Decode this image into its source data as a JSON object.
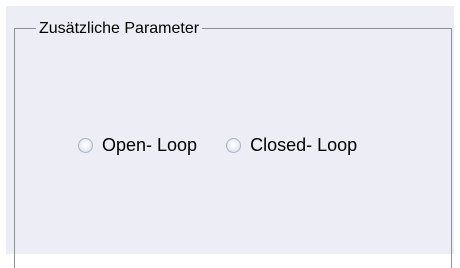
{
  "groupbox": {
    "title": "Zusätzliche Parameter"
  },
  "options": [
    {
      "label": "Open- Loop",
      "selected": false
    },
    {
      "label": "Closed- Loop",
      "selected": false
    }
  ],
  "colors": {
    "panel_background": "#ecedf5",
    "border": "#8d9096",
    "radio_border": "#a8b4c2"
  }
}
